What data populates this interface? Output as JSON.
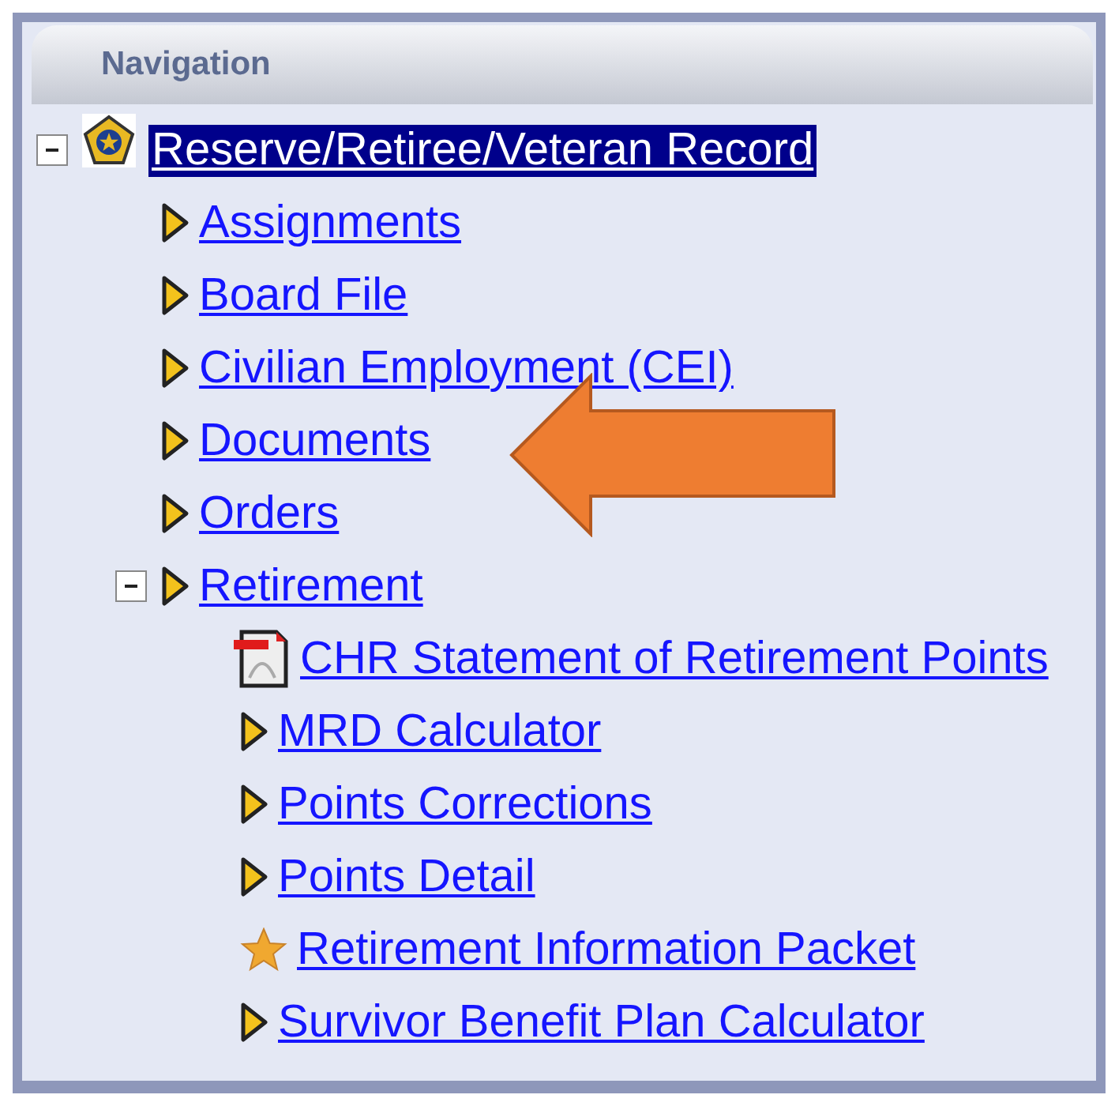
{
  "panel": {
    "title": "Navigation"
  },
  "tree": [
    {
      "label": "Reserve/Retiree/Veteran Record",
      "kind": "emblem",
      "expanded": true,
      "selected": true,
      "children": [
        {
          "label": "Assignments",
          "kind": "arrow",
          "selected": false
        },
        {
          "label": "Board File",
          "kind": "arrow",
          "selected": false
        },
        {
          "label": "Civilian Employment (CEI)",
          "kind": "arrow",
          "selected": false
        },
        {
          "label": "Documents",
          "kind": "arrow",
          "selected": false
        },
        {
          "label": "Orders",
          "kind": "arrow",
          "selected": false
        },
        {
          "label": "Retirement",
          "kind": "arrow",
          "expanded": true,
          "selected": false,
          "children": [
            {
              "label": "CHR Statement of Retirement Points",
              "kind": "pdf",
              "selected": false
            },
            {
              "label": "MRD Calculator",
              "kind": "arrow",
              "selected": false
            },
            {
              "label": "Points Corrections",
              "kind": "arrow",
              "selected": false
            },
            {
              "label": "Points Detail",
              "kind": "arrow",
              "selected": false
            },
            {
              "label": "Retirement Information Packet",
              "kind": "star",
              "selected": false
            },
            {
              "label": "Survivor Benefit Plan Calculator",
              "kind": "arrow",
              "selected": false
            }
          ]
        }
      ]
    }
  ]
}
